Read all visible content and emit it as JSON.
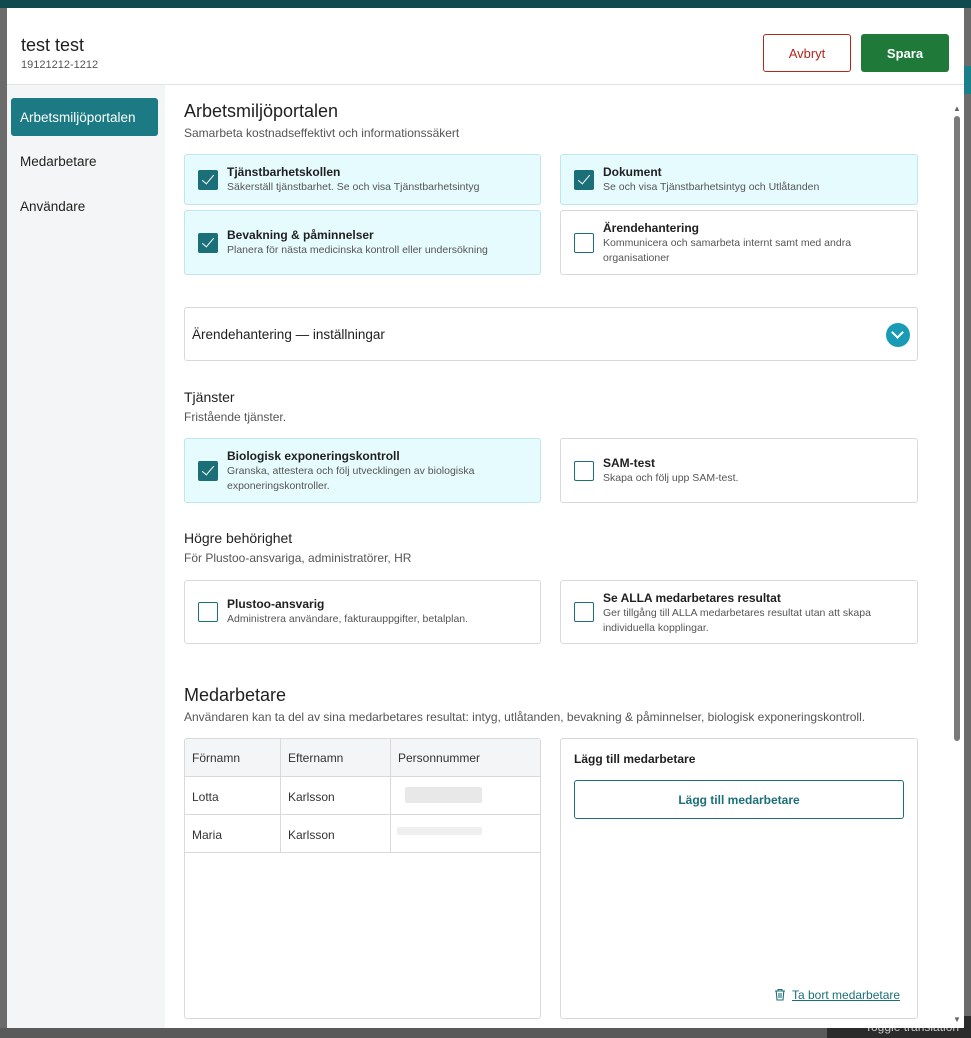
{
  "background": {
    "toggle_text": "Toggle translation"
  },
  "header": {
    "name": "test test",
    "personnummer": "19121212-1212",
    "cancel_label": "Avbryt",
    "save_label": "Spara"
  },
  "sidebar": {
    "items": [
      {
        "label": "Arbetsmiljöportalen",
        "active": true
      },
      {
        "label": "Medarbetare",
        "active": false
      },
      {
        "label": "Användare",
        "active": false
      }
    ]
  },
  "portal": {
    "title": "Arbetsmiljöportalen",
    "subtitle": "Samarbeta kostnadseffektivt och informationssäkert",
    "modules": [
      {
        "title": "Tjänstbarhetskollen",
        "desc": "Säkerställ tjänstbarhet. Se och visa Tjänstbarhetsintyg",
        "checked": true
      },
      {
        "title": "Dokument",
        "desc": "Se och visa Tjänstbarhetsintyg och Utlåtanden",
        "checked": true
      },
      {
        "title": "Bevakning & påminnelser",
        "desc": "Planera för nästa medicinska kontroll eller undersökning",
        "checked": true
      },
      {
        "title": "Ärendehantering",
        "desc_line1": "Kommunicera och samarbeta internt samt med andra",
        "desc_line2": "organisationer",
        "checked": false
      }
    ],
    "accordion_label": "Ärendehantering — inställningar"
  },
  "services": {
    "title": "Tjänster",
    "subtitle": "Fristående tjänster.",
    "items": [
      {
        "title": "Biologisk exponeringskontroll",
        "desc_line1": "Granska, attestera och följ utvecklingen av biologiska",
        "desc_line2": "exponeringskontroller.",
        "checked": true
      },
      {
        "title": "SAM-test",
        "desc": "Skapa och följ upp SAM-test.",
        "checked": false
      }
    ]
  },
  "rights": {
    "title": "Högre behörighet",
    "subtitle": "För Plustoo-ansvariga, administratörer, HR",
    "items": [
      {
        "title": "Plustoo-ansvarig",
        "desc": "Administrera användare, fakturauppgifter, betalplan.",
        "checked": false
      },
      {
        "title": "Se ALLA medarbetares resultat",
        "desc_line1": "Ger tillgång till ALLA medarbetares resultat utan att skapa",
        "desc_line2": "individuella kopplingar.",
        "checked": false
      }
    ]
  },
  "employees": {
    "title": "Medarbetare",
    "subtitle": "Användaren kan ta del av sina medarbetares resultat: intyg, utlåtanden, bevakning & påminnelser, biologisk exponeringskontroll.",
    "columns": [
      "Förnamn",
      "Efternamn",
      "Personnummer"
    ],
    "rows": [
      {
        "first": "Lotta",
        "last": "Karlsson"
      },
      {
        "first": "Maria",
        "last": "Karlsson"
      }
    ],
    "add_title": "Lägg till medarbetare",
    "add_button": "Lägg till medarbetare",
    "remove_link": "Ta bort medarbetare"
  },
  "colors": {
    "accent": "#1b7a83",
    "save": "#1f7a3a",
    "cancel": "#b3261e",
    "checked_bg": "#e6fbfd"
  }
}
